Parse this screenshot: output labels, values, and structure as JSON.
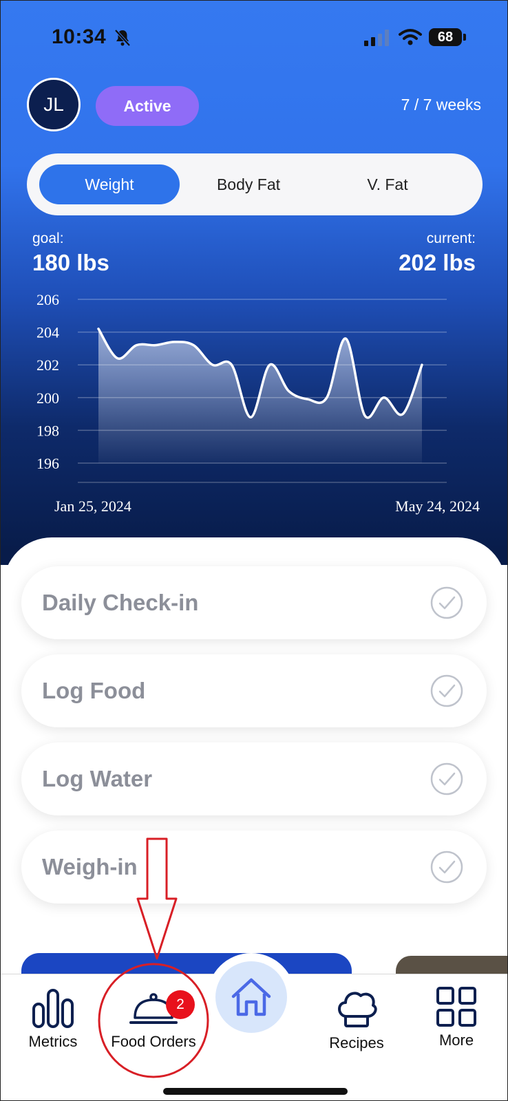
{
  "status_bar": {
    "time": "10:34",
    "battery": "68"
  },
  "header": {
    "avatar_initials": "JL",
    "status_badge": "Active",
    "progress": "7 / 7 weeks"
  },
  "metric_tabs": [
    {
      "label": "Weight",
      "active": true
    },
    {
      "label": "Body Fat",
      "active": false
    },
    {
      "label": "V. Fat",
      "active": false
    }
  ],
  "goal": {
    "label": "goal:",
    "value": "180 lbs"
  },
  "current": {
    "label": "current:",
    "value": "202 lbs"
  },
  "chart_data": {
    "type": "area",
    "x_start_label": "Jan 25, 2024",
    "x_end_label": "May 24, 2024",
    "y_ticks": [
      "206",
      "204",
      "202",
      "200",
      "198",
      "196"
    ],
    "ylim": [
      195,
      206
    ],
    "grid": true,
    "values": [
      204.2,
      202.4,
      203.2,
      203.2,
      203.4,
      203.2,
      202,
      202,
      198.8,
      202,
      200.4,
      199.9,
      200,
      203.6,
      198.9,
      200,
      199,
      202
    ]
  },
  "tasks": [
    {
      "label": "Daily Check-in"
    },
    {
      "label": "Log Food"
    },
    {
      "label": "Log Water"
    },
    {
      "label": "Weigh-in"
    }
  ],
  "tab_bar": {
    "metrics": "Metrics",
    "food_orders": "Food Orders",
    "food_orders_badge": "2",
    "recipes": "Recipes",
    "more": "More"
  },
  "colors": {
    "accent": "#2e73ea",
    "active_badge": "#8f6cf7",
    "notification": "#e8111c",
    "annotation": "#d81f26"
  }
}
